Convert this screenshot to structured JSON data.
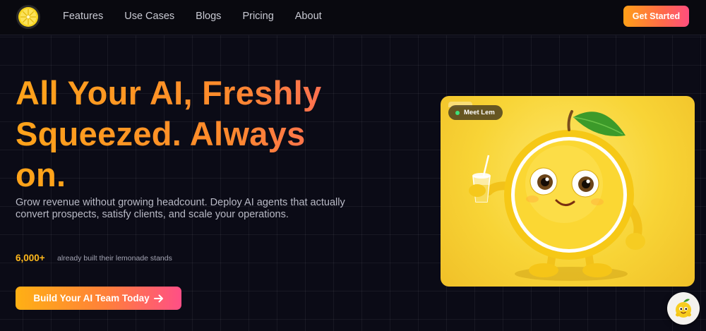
{
  "nav": {
    "links": [
      "Features",
      "Use Cases",
      "Blogs",
      "Pricing",
      "About"
    ],
    "cta": "Get Started"
  },
  "hero": {
    "headline_lines": [
      "All Your AI, Freshly",
      "Squeezed. Always",
      "on."
    ],
    "subtitle": "Grow revenue without growing headcount. Deploy AI agents that actually convert prospects, satisfy clients, and scale your operations.",
    "stat_number": "6,000+",
    "stat_text": "already built their lemonade stands",
    "cta": "Build Your AI Team Today",
    "cta_icon": "arrow-right-icon"
  },
  "card": {
    "badge": "Meet Lem",
    "status_color": "#3ee07a"
  },
  "colors": {
    "accent_orange": "#ffa31a",
    "accent_pink": "#ff4e7e",
    "background": "#0b0b16"
  }
}
